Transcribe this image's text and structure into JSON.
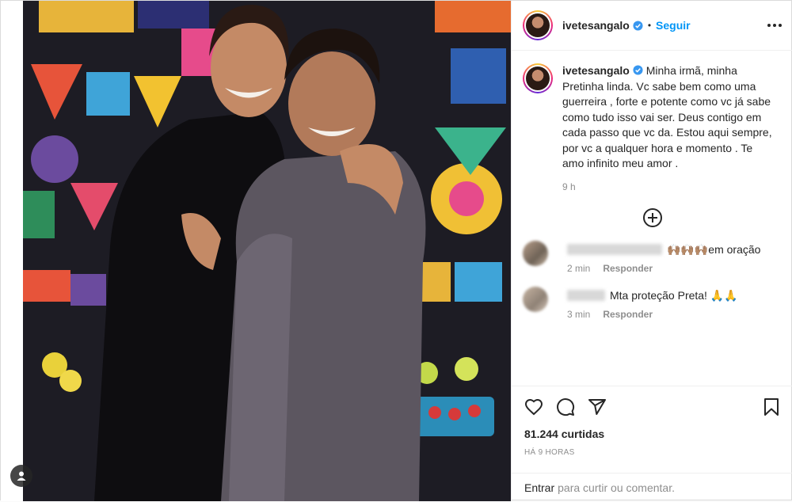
{
  "post": {
    "author": "ivetesangalo",
    "follow_label": "Seguir",
    "separator": "•",
    "caption": "Minha irmã, minha Pretinha linda. Vc sabe bem como uma guerreira , forte e potente como vc já sabe como tudo isso vai ser. Deus contigo em cada passo que vc da. Estou aqui sempre, por vc a qualquer hora e momento . Te amo infinito meu amor .",
    "caption_time": "9 h",
    "likes": "81.244 curtidas",
    "age": "HÁ 9 HORAS"
  },
  "comments": [
    {
      "text": "🙌🏽🙌🏽🙌🏽em oração",
      "time": "2 min",
      "reply": "Responder"
    },
    {
      "text": "Mta proteção Preta! 🙏🙏",
      "time": "3 min",
      "reply": "Responder"
    }
  ],
  "login": {
    "link": "Entrar",
    "rest": "para curtir ou comentar."
  },
  "icons": [
    "heart-icon",
    "comment-icon",
    "share-icon",
    "bookmark-icon",
    "add-comment-icon",
    "more-icon",
    "verified-icon",
    "user-tag-icon"
  ],
  "colors": {
    "accent": "#0095f6",
    "verified": "#3897f0",
    "muted": "#8e8e8e",
    "text": "#262626"
  }
}
